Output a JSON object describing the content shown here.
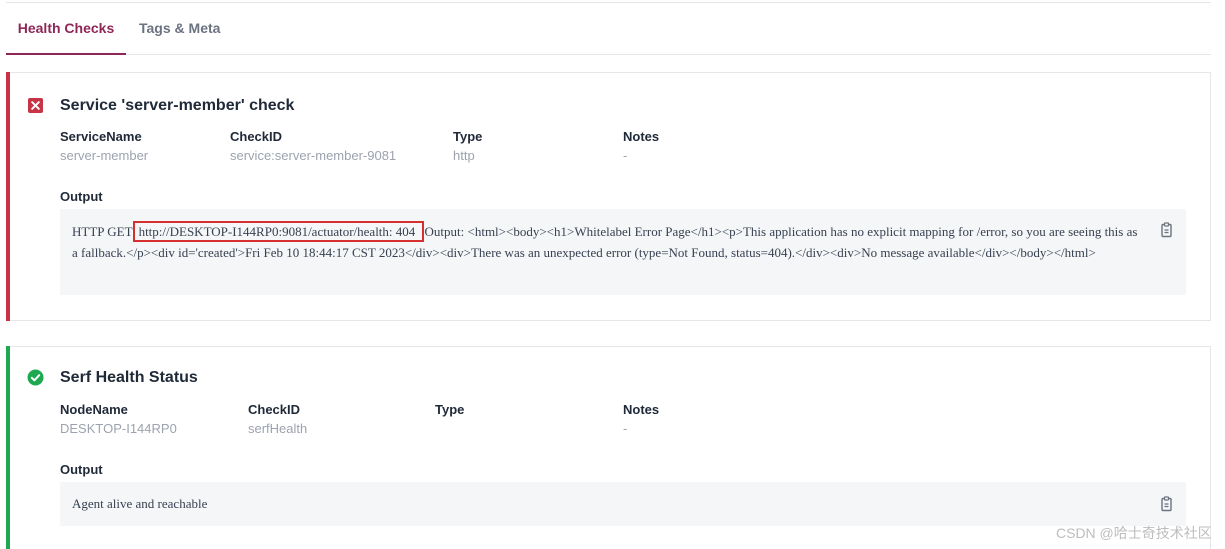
{
  "tabs": [
    {
      "label": "Health Checks",
      "active": true
    },
    {
      "label": "Tags & Meta",
      "active": false
    }
  ],
  "checks": [
    {
      "status": "critical",
      "status_icon": "x-square-icon",
      "status_color": "#c73445",
      "title": "Service 'server-member' check",
      "fields": [
        {
          "label": "ServiceName",
          "value": "server-member"
        },
        {
          "label": "CheckID",
          "value": "service:server-member-9081"
        },
        {
          "label": "Type",
          "value": "http"
        },
        {
          "label": "Notes",
          "value": "-"
        }
      ],
      "output_label": "Output",
      "output_prefix": "HTTP GET",
      "output_url": "http://DESKTOP-I144RP0:9081/actuator/health: 404",
      "output_rest": "Output: <html><body><h1>Whitelabel Error Page</h1><p>This application has no explicit mapping for /error, so you are seeing this as a fallback.</p><div id='created'>Fri Feb 10 18:44:17 CST 2023</div><div>There was an unexpected error (type=Not Found, status=404).</div><div>No message available</div></body></html>",
      "copy_icon": "copy-icon"
    },
    {
      "status": "passing",
      "status_icon": "check-circle-icon",
      "status_color": "#1ea951",
      "title": "Serf Health Status",
      "fields": [
        {
          "label": "NodeName",
          "value": "DESKTOP-I144RP0"
        },
        {
          "label": "CheckID",
          "value": "serfHealth"
        },
        {
          "label": "Type",
          "value": ""
        },
        {
          "label": "Notes",
          "value": "-"
        }
      ],
      "output_label": "Output",
      "output_text": "Agent alive and reachable",
      "copy_icon": "copy-icon"
    }
  ],
  "watermark": "CSDN @哈士奇技术社区"
}
